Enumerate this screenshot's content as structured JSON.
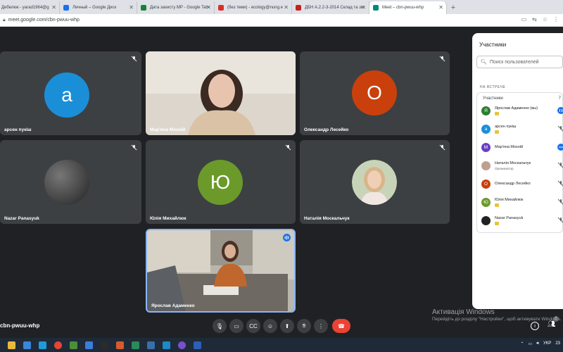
{
  "browser": {
    "tabs": [
      {
        "label": "Дебелюк - yarad1964@g",
        "color": "#d93025"
      },
      {
        "label": "Личный – Google Диск",
        "color": "#1a73e8"
      },
      {
        "label": "Дата захисту МР - Google Tab",
        "color": "#188038"
      },
      {
        "label": "(без теми) - ecology@nung.e",
        "color": "#d93025"
      },
      {
        "label": "ДБН А.2.2-3-2014 Склад та зм",
        "color": "#c5221f"
      },
      {
        "label": "Meet – cbn-pwuu-whp",
        "color": "#00897b",
        "active": true
      }
    ],
    "new_tab": "+",
    "url": "meet.google.com/cbn-pwuu-whp"
  },
  "tiles": [
    {
      "name": "арсен пукіш",
      "initial": "а",
      "avatar_color": "#1a8fd8",
      "muted": true
    },
    {
      "name": "Мар'яна Мохній",
      "initial": "",
      "avatar_color": "",
      "muted": false,
      "video": true
    },
    {
      "name": "Олександр Лесейко",
      "initial": "О",
      "avatar_color": "#c9400c",
      "muted": true
    },
    {
      "name": "Nazar Panasyuk",
      "initial": "",
      "avatar_color": "#444",
      "muted": true
    },
    {
      "name": "Юлія Михайлюк",
      "initial": "Ю",
      "avatar_color": "#6b9a2a",
      "muted": true
    },
    {
      "name": "Наталія Москальчук",
      "initial": "",
      "avatar_color": "",
      "muted": true
    },
    {
      "name": "Ярослав Адаменко",
      "initial": "",
      "avatar_color": "",
      "muted": false,
      "video": true,
      "self": true
    }
  ],
  "panel": {
    "title": "Участники",
    "search_placeholder": "Поиск пользователей",
    "section": "НА ВСТРЕЧЕ",
    "list_header": "Участники",
    "list_count": "7",
    "participants": [
      {
        "name": "Ярослав Адаменко (вы)",
        "initial": "Я",
        "color": "#2e7d32",
        "sub": ""
      },
      {
        "name": "арсен пукіш",
        "initial": "а",
        "color": "#1a8fd8",
        "sub": ""
      },
      {
        "name": "Мар'яна Мохній",
        "initial": "М",
        "color": "#6a3fc1",
        "sub": ""
      },
      {
        "name": "Наталія Москальчук",
        "initial": "",
        "color": "#bfa090",
        "sub": "Организатор"
      },
      {
        "name": "Олександр Лесейко",
        "initial": "О",
        "color": "#c9400c",
        "sub": ""
      },
      {
        "name": "Юлія Михайлюк",
        "initial": "Ю",
        "color": "#6b9a2a",
        "sub": ""
      },
      {
        "name": "Nazar Panasyuk",
        "initial": "",
        "color": "#222",
        "sub": ""
      }
    ]
  },
  "bottom": {
    "meeting_code": "cbn-pwuu-whp",
    "controls": [
      "mic-icon",
      "camera-icon",
      "captions-icon",
      "emoji-icon",
      "present-icon",
      "raise-hand-icon",
      "more-icon",
      "hangup-icon"
    ],
    "counter": "7"
  },
  "watermark": {
    "line1": "Активація Windows",
    "line2": "Перейдіть до розділу \"Настройки\", щоб активувати Windows."
  },
  "tray": {
    "lang": "УКР",
    "time": "23"
  }
}
